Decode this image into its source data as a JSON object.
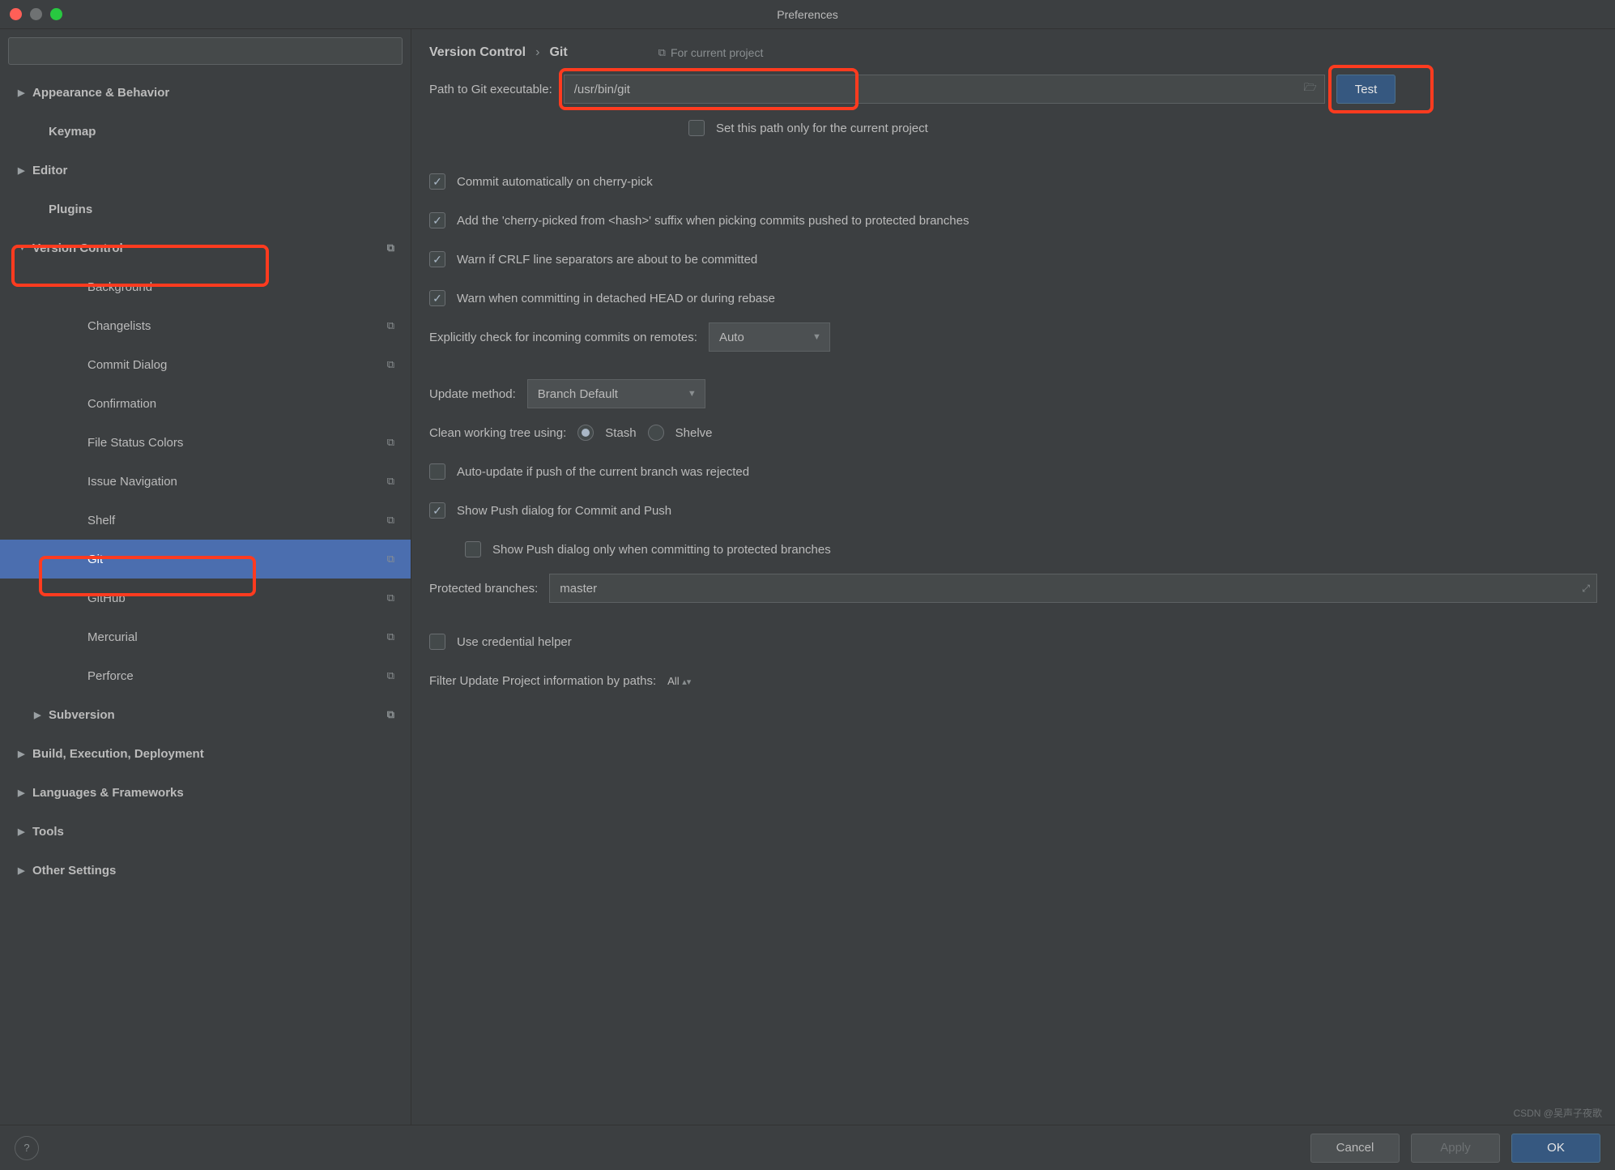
{
  "window": {
    "title": "Preferences"
  },
  "search": {
    "placeholder": ""
  },
  "sidebar": {
    "items": [
      {
        "label": "Appearance & Behavior",
        "depth": 0,
        "bold": true,
        "arrow": "▶"
      },
      {
        "label": "Keymap",
        "depth": 1,
        "bold": true
      },
      {
        "label": "Editor",
        "depth": 0,
        "bold": true,
        "arrow": "▶"
      },
      {
        "label": "Plugins",
        "depth": 1,
        "bold": true
      },
      {
        "label": "Version Control",
        "depth": 0,
        "bold": true,
        "arrow": "▼",
        "copy": true
      },
      {
        "label": "Background",
        "depth": 2
      },
      {
        "label": "Changelists",
        "depth": 2,
        "copy": true
      },
      {
        "label": "Commit Dialog",
        "depth": 2,
        "copy": true
      },
      {
        "label": "Confirmation",
        "depth": 2
      },
      {
        "label": "File Status Colors",
        "depth": 2,
        "copy": true
      },
      {
        "label": "Issue Navigation",
        "depth": 2,
        "copy": true
      },
      {
        "label": "Shelf",
        "depth": 2,
        "copy": true
      },
      {
        "label": "Git",
        "depth": 2,
        "copy": true,
        "selected": true
      },
      {
        "label": "GitHub",
        "depth": 2,
        "copy": true
      },
      {
        "label": "Mercurial",
        "depth": 2,
        "copy": true
      },
      {
        "label": "Perforce",
        "depth": 2,
        "copy": true
      },
      {
        "label": "Subversion",
        "depth": 1,
        "bold": true,
        "arrow": "▶",
        "copy": true
      },
      {
        "label": "Build, Execution, Deployment",
        "depth": 0,
        "bold": true,
        "arrow": "▶"
      },
      {
        "label": "Languages & Frameworks",
        "depth": 0,
        "bold": true,
        "arrow": "▶"
      },
      {
        "label": "Tools",
        "depth": 0,
        "bold": true,
        "arrow": "▶"
      },
      {
        "label": "Other Settings",
        "depth": 0,
        "bold": true,
        "arrow": "▶"
      }
    ]
  },
  "breadcrumb": {
    "a": "Version Control",
    "b": "Git",
    "project_badge": "For current project"
  },
  "form": {
    "path_label": "Path to Git executable:",
    "path_value": "/usr/bin/git",
    "test_label": "Test",
    "path_only_current": "Set this path only for the current project",
    "cb_cherry_auto": "Commit automatically on cherry-pick",
    "cb_cherry_suffix": "Add the 'cherry-picked from <hash>' suffix when picking commits pushed to protected branches",
    "cb_crlf": "Warn if CRLF line separators are about to be committed",
    "cb_detached": "Warn when committing in detached HEAD or during rebase",
    "explicit_label": "Explicitly check for incoming commits on remotes:",
    "explicit_value": "Auto",
    "update_label": "Update method:",
    "update_value": "Branch Default",
    "clean_label": "Clean working tree using:",
    "clean_opt1": "Stash",
    "clean_opt2": "Shelve",
    "cb_autoupdate": "Auto-update if push of the current branch was rejected",
    "cb_showpush": "Show Push dialog for Commit and Push",
    "cb_showpush_protected": "Show Push dialog only when committing to protected branches",
    "protected_label": "Protected branches:",
    "protected_value": "master",
    "cb_cred": "Use credential helper",
    "filter_label": "Filter Update Project information by paths:",
    "filter_value": "All"
  },
  "footer": {
    "cancel": "Cancel",
    "apply": "Apply",
    "ok": "OK"
  },
  "watermark": "CSDN @吴声子夜歌"
}
